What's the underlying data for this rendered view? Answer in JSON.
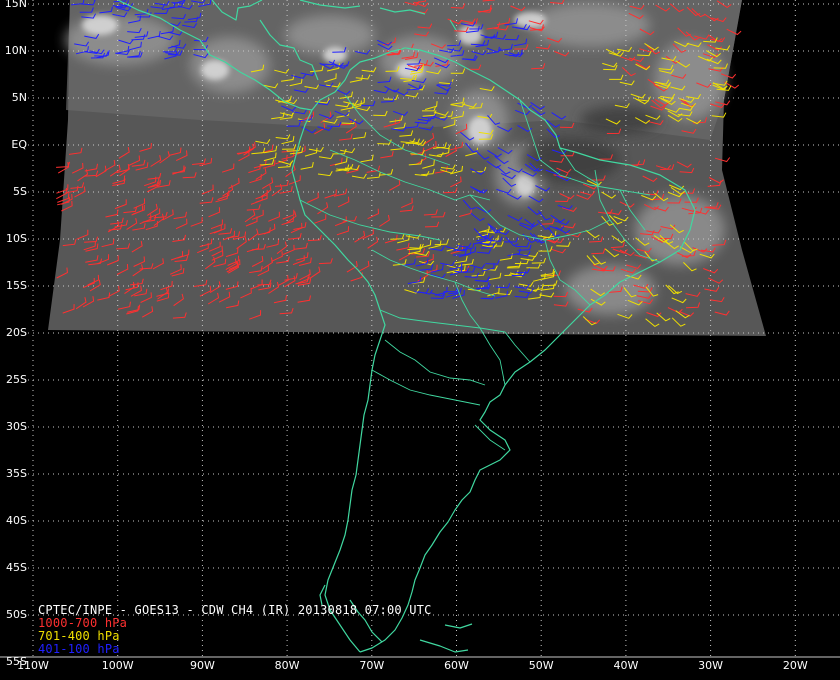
{
  "title": "CPTEC/INPE - GOES13 - CDW CH4 (IR) 20130818 07:00 UTC",
  "legend": [
    {
      "label": "1000-700 hPa",
      "color": "#ff3030"
    },
    {
      "label": "701-400 hPa",
      "color": "#f0e000"
    },
    {
      "label": "401-100 hPa",
      "color": "#2020ff"
    }
  ],
  "colors": {
    "background": "#000000",
    "coastline": "#40d8a0",
    "grid": "#c8c8c8",
    "satellite": "#5a5a5a"
  },
  "lat_labels": [
    "15N",
    "10N",
    "5N",
    "EQ",
    "5S",
    "10S",
    "15S",
    "20S",
    "25S",
    "30S",
    "35S",
    "40S",
    "45S",
    "50S",
    "55S"
  ],
  "lon_labels": [
    "110W",
    "100W",
    "90W",
    "80W",
    "70W",
    "60W",
    "50W",
    "40W",
    "30W",
    "20W"
  ]
}
